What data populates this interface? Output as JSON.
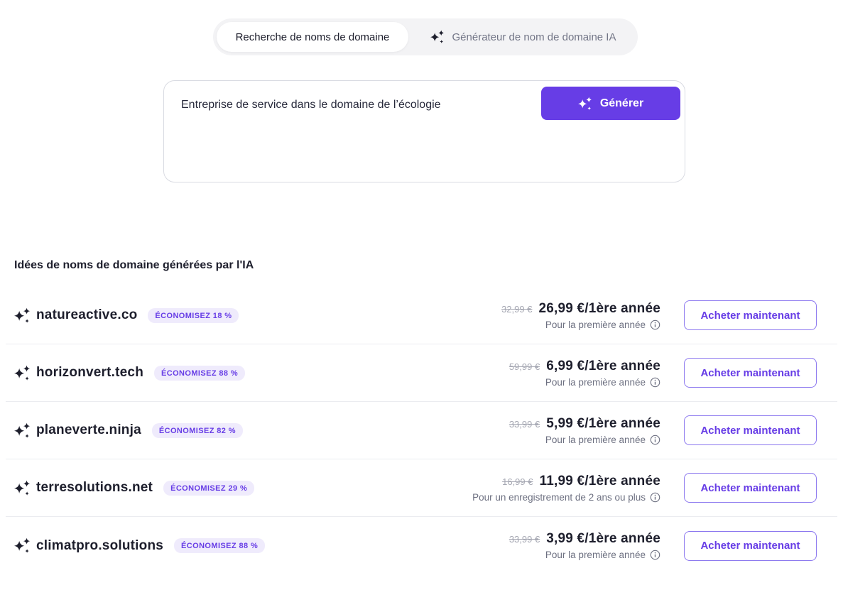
{
  "tabbar": {
    "search_tab": "Recherche de noms de domaine",
    "ai_tab": "Générateur de nom de domaine IA"
  },
  "form": {
    "prompt": "Entreprise de service dans le domaine de l’écologie",
    "generate_button": "Générer"
  },
  "results": {
    "heading": "Idées de noms de domaine générées par l'IA",
    "buy_button": "Acheter maintenant",
    "rows": [
      {
        "domain": "natureactive.co",
        "badge": "ÉCONOMISEZ 18 %",
        "old_price": "32,99 €",
        "price": "26,99 €/1ère année",
        "note": "Pour la première année"
      },
      {
        "domain": "horizonvert.tech",
        "badge": "ÉCONOMISEZ 88 %",
        "old_price": "59,99 €",
        "price": "6,99 €/1ère année",
        "note": "Pour la première année"
      },
      {
        "domain": "planeverte.ninja",
        "badge": "ÉCONOMISEZ 82 %",
        "old_price": "33,99 €",
        "price": "5,99 €/1ère année",
        "note": "Pour la première année"
      },
      {
        "domain": "terresolutions.net",
        "badge": "ÉCONOMISEZ 29 %",
        "old_price": "16,99 €",
        "price": "11,99 €/1ère année",
        "note": "Pour un enregistrement de 2 ans ou plus"
      },
      {
        "domain": "climatpro.solutions",
        "badge": "ÉCONOMISEZ 88 %",
        "old_price": "33,99 €",
        "price": "3,99 €/1ère année",
        "note": "Pour la première année"
      }
    ]
  },
  "colors": {
    "accent": "#673de6",
    "badge_bg": "#efebfc",
    "text_dark": "#1d1e2c",
    "text_gray": "#6d7081",
    "strike_gray": "#a6a8b3",
    "divider": "#ebecf0",
    "tabbar_bg": "#f3f3f5"
  }
}
